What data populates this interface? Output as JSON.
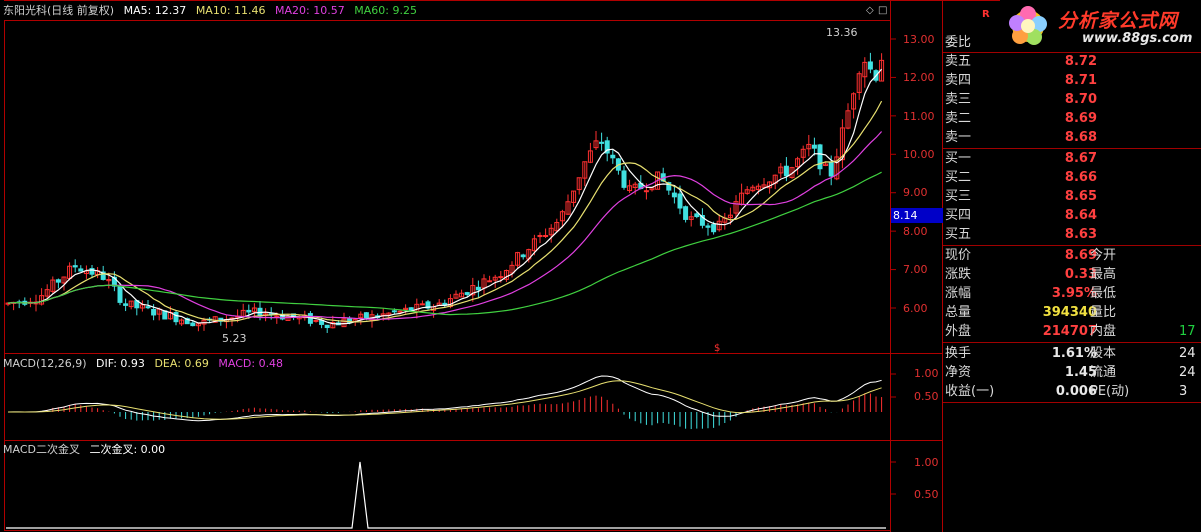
{
  "header": {
    "title": "东阳光科(日线 前复权)",
    "ma5": "MA5: 12.37",
    "ma10": "MA10: 11.46",
    "ma20": "MA20: 10.57",
    "ma60": "MA60: 9.25",
    "macd_title": "MACD(12,26,9)",
    "dif": "DIF: 0.93",
    "dea": "DEA: 0.69",
    "macd": "MACD: 0.48",
    "ind2_title": "MACD二次金叉",
    "ind2_value": "二次金叉: 0.00"
  },
  "colors": {
    "up": "#ff3030",
    "down": "#40e0e0",
    "ma5": "#ffffff",
    "ma10": "#e8e070",
    "ma20": "#e040e0",
    "ma60": "#40d040",
    "border": "#b00000"
  },
  "price_axis": [
    "13.00",
    "12.00",
    "11.00",
    "10.00",
    "9.00",
    "8.00",
    "7.00",
    "6.00"
  ],
  "macd_axis": [
    "1.00",
    "0.50"
  ],
  "ind2_axis": [
    "1.00",
    "0.50"
  ],
  "current_price_tag": "8.14",
  "annotations": {
    "high": "13.36",
    "low": "5.23",
    "marker": "$"
  },
  "icons": {
    "top_right": [
      "diamond-icon",
      "square-icon"
    ],
    "corner": "R"
  },
  "logo": {
    "title": "分析家公式网",
    "url": "www.88gs.com"
  },
  "quote": {
    "ratio_label": "委比",
    "asks": [
      {
        "label": "卖五",
        "price": "8.72"
      },
      {
        "label": "卖四",
        "price": "8.71"
      },
      {
        "label": "卖三",
        "price": "8.70"
      },
      {
        "label": "卖二",
        "price": "8.69"
      },
      {
        "label": "卖一",
        "price": "8.68"
      }
    ],
    "bids": [
      {
        "label": "买一",
        "price": "8.67"
      },
      {
        "label": "买二",
        "price": "8.66"
      },
      {
        "label": "买三",
        "price": "8.65"
      },
      {
        "label": "买四",
        "price": "8.64"
      },
      {
        "label": "买五",
        "price": "8.63"
      }
    ],
    "stats": [
      {
        "label": "现价",
        "value": "8.69",
        "label2": "今开",
        "value2": ""
      },
      {
        "label": "涨跌",
        "value": "0.33",
        "label2": "最高",
        "value2": ""
      },
      {
        "label": "涨幅",
        "value": "3.95%",
        "label2": "最低",
        "value2": ""
      },
      {
        "label": "总量",
        "value": "394340",
        "label2": "量比",
        "value2": ""
      },
      {
        "label": "外盘",
        "value": "214707",
        "label2": "内盘",
        "value2": "17"
      }
    ],
    "fund": [
      {
        "label": "换手",
        "value": "1.61%",
        "label2": "股本",
        "value2": "24"
      },
      {
        "label": "净资",
        "value": "1.45",
        "label2": "流通",
        "value2": "24"
      },
      {
        "label": "收益(一)",
        "value": "0.006",
        "label2": "PE(动)",
        "value2": "3"
      }
    ]
  }
}
